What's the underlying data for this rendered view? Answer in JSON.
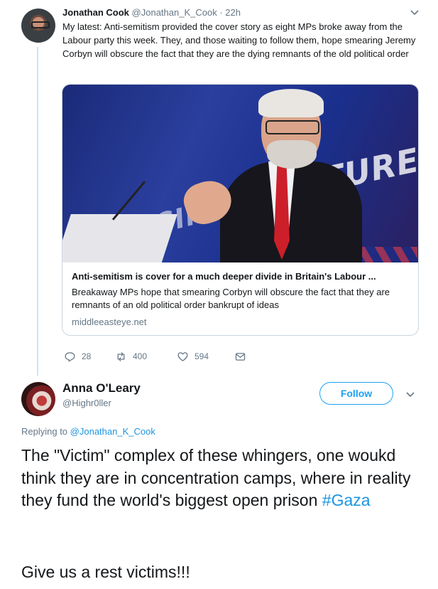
{
  "tweet1": {
    "author_name": "Jonathan Cook",
    "author_handle": "@Jonathan_K_Cook",
    "separator": "·",
    "time": "22h",
    "text": "My latest: Anti-semitism provided the cover story as eight MPs broke away from the Labour party this week. They, and those waiting to follow them, hope smearing Jeremy Corbyn will obscure the fact that they are the dying remnants of the old political order",
    "card": {
      "image_text_1": "FACING",
      "image_text_2": "FUTURE",
      "title": "Anti-semitism is cover for a much deeper divide in Britain's Labour ...",
      "description": "Breakaway MPs hope that smearing Corbyn will obscure the fact that they are remnants of an old political order bankrupt of ideas",
      "domain": "middleeasteye.net"
    },
    "actions": {
      "replies": "28",
      "retweets": "400",
      "likes": "594"
    }
  },
  "tweet2": {
    "author_name": "Anna O'Leary",
    "author_handle": "@Highr0ller",
    "follow_label": "Follow",
    "replying_prefix": "Replying to ",
    "replying_mention": "@Jonathan_K_Cook",
    "text_main": "The \"Victim\" complex of these whingers, one woukd think they are in concentration camps, where in reality they fund the world's biggest open prison ",
    "hashtag": "#Gaza",
    "text_last": "Give us a rest victims!!!"
  },
  "colors": {
    "accent": "#1da1f2",
    "link": "#1b95e0",
    "secondary_text": "#657786",
    "border": "#ccd6dd"
  },
  "icons": [
    "reply-icon",
    "retweet-icon",
    "like-icon",
    "direct-message-icon",
    "chevron-down-icon"
  ]
}
